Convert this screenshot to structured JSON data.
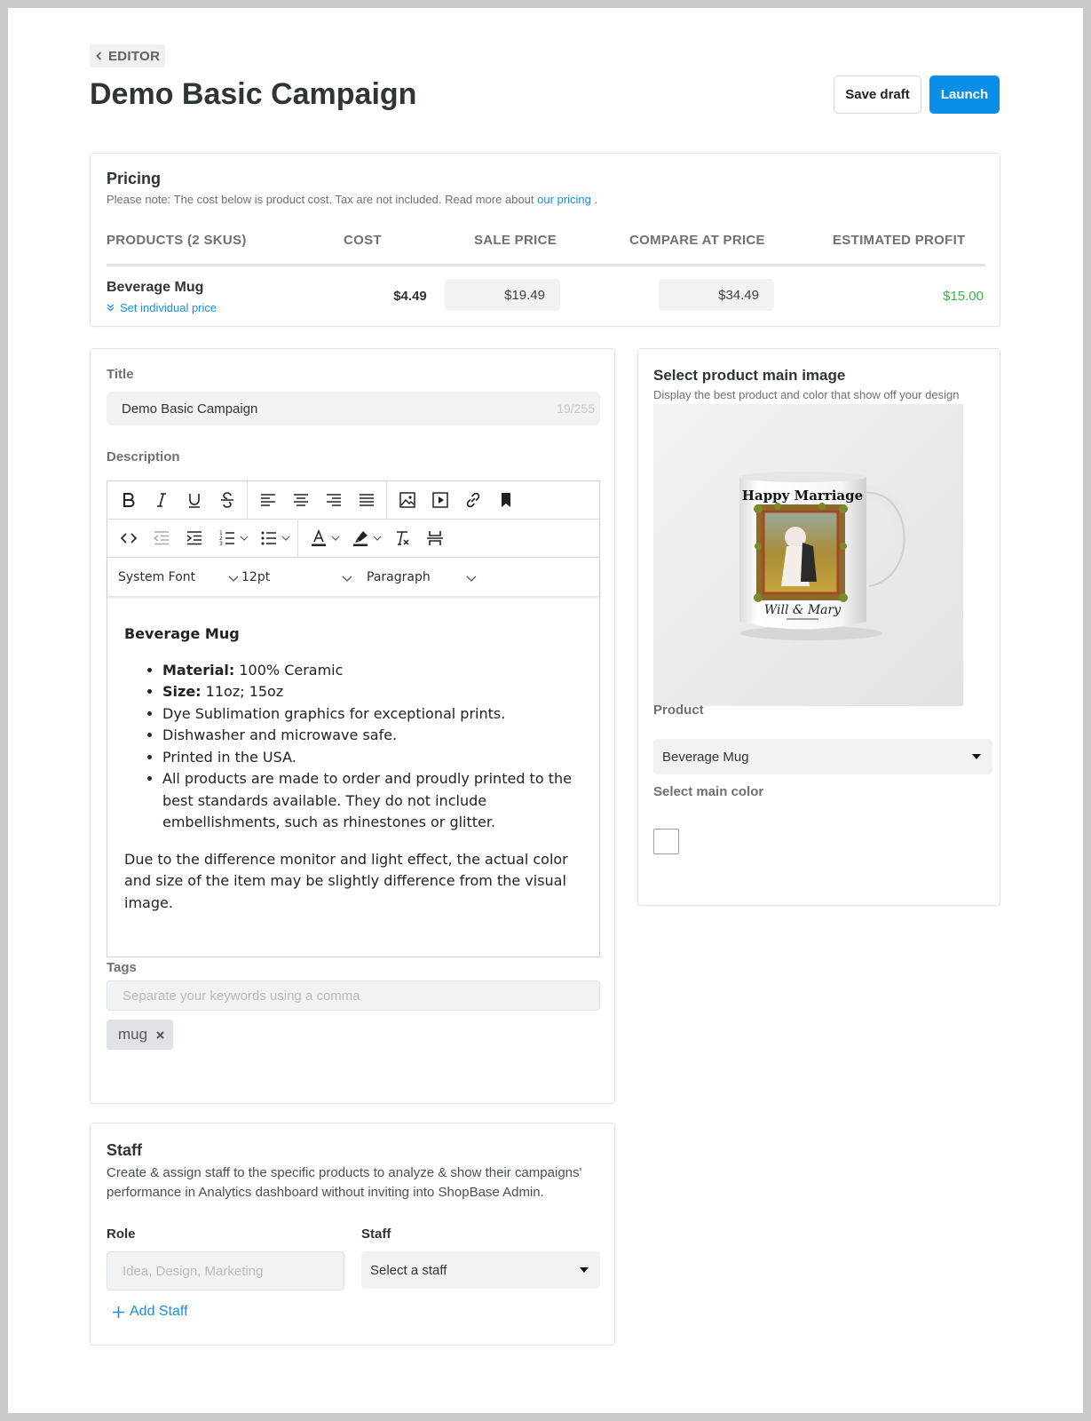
{
  "header": {
    "back_label": "EDITOR",
    "title": "Demo Basic Campaign",
    "save_draft": "Save draft",
    "launch": "Launch"
  },
  "pricing": {
    "title": "Pricing",
    "note_prefix": "Please note: The cost below is product cost. Tax are not included. Read more about ",
    "note_link": "our pricing",
    "note_suffix": " .",
    "columns": {
      "products": "PRODUCTS (2 SKUS)",
      "cost": "COST",
      "sale_price": "SALE PRICE",
      "compare_at_price": "COMPARE AT PRICE",
      "estimated_profit": "ESTIMATED PROFIT"
    },
    "row": {
      "product": "Beverage Mug",
      "set_individual": "Set individual price",
      "cost": "$4.49",
      "sale_price": "$19.49",
      "compare_at_price": "$34.49",
      "profit": "$15.00"
    },
    "profit_color": "#3db34f"
  },
  "form": {
    "title_label": "Title",
    "title_value": "Demo Basic Campaign",
    "title_count": "19/255",
    "description_label": "Description",
    "editor": {
      "font": "System Font",
      "size": "12pt",
      "block": "Paragraph",
      "heading": "Beverage Mug",
      "bullets": [
        {
          "bold": "Material:",
          "text": " 100% Ceramic"
        },
        {
          "bold": "Size:",
          "text": " 11oz; 15oz"
        },
        {
          "bold": "",
          "text": "Dye Sublimation graphics for exceptional prints."
        },
        {
          "bold": "",
          "text": "Dishwasher and microwave safe."
        },
        {
          "bold": "",
          "text": "Printed in the USA."
        },
        {
          "bold": "",
          "text": "All products are made to order and proudly printed to the best standards available. They do not include embellishments, such as rhinestones or glitter."
        }
      ],
      "footer_paragraph": "Due to the difference monitor and light effect, the actual color and size of the item may be slightly difference from the visual image."
    },
    "tags_label": "Tags",
    "tags_placeholder": "Separate your keywords using a comma",
    "tags": [
      "mug"
    ]
  },
  "staff": {
    "title": "Staff",
    "description": "Create & assign staff to the specific products to analyze & show their campaigns' performance in Analytics dashboard without inviting into ShopBase Admin.",
    "role_label": "Role",
    "role_placeholder": "Idea, Design, Marketing",
    "staff_label": "Staff",
    "staff_select": "Select a staff",
    "add_staff": "Add Staff"
  },
  "main_image": {
    "title": "Select product main image",
    "subtitle": "Display the best product and color that show off your design",
    "mug_text_top": "Happy Marriage",
    "mug_text_bottom": "Will & Mary",
    "product_label": "Product",
    "product_value": "Beverage Mug",
    "color_label": "Select main color"
  },
  "colors": {
    "accent": "#0a8ee8",
    "link": "#1a8ee0"
  }
}
